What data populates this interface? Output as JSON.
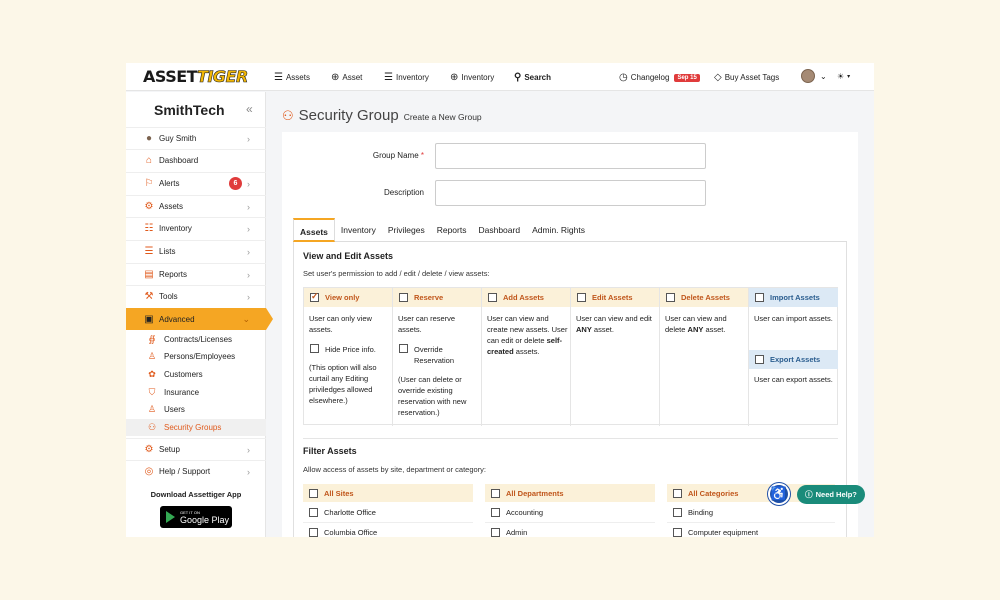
{
  "brand": {
    "logo_a": "ASSET",
    "logo_b": "TIGER"
  },
  "topnav": {
    "items": [
      {
        "icon": "list-icon",
        "label": "Assets"
      },
      {
        "icon": "plus-circle-icon",
        "label": "Asset"
      },
      {
        "icon": "list-icon",
        "label": "Inventory"
      },
      {
        "icon": "plus-circle-icon",
        "label": "Inventory"
      },
      {
        "icon": "search-icon",
        "label": "Search"
      }
    ],
    "changelog": "Changelog",
    "changelog_badge": "Sep 15",
    "buy_tags": "Buy Asset Tags"
  },
  "sidebar": {
    "company": "SmithTech",
    "items": [
      {
        "label": "Guy Smith",
        "icon": "user-avatar-icon"
      },
      {
        "label": "Dashboard",
        "icon": "home-icon"
      },
      {
        "label": "Alerts",
        "icon": "flag-icon",
        "badge": "6"
      },
      {
        "label": "Assets",
        "icon": "gear-icon"
      },
      {
        "label": "Inventory",
        "icon": "inventory-icon"
      },
      {
        "label": "Lists",
        "icon": "list-icon"
      },
      {
        "label": "Reports",
        "icon": "report-icon"
      },
      {
        "label": "Tools",
        "icon": "wrench-icon"
      },
      {
        "label": "Advanced",
        "icon": "briefcase-icon"
      }
    ],
    "subitems": [
      {
        "label": "Contracts/Licenses",
        "icon": "contract-icon"
      },
      {
        "label": "Persons/Employees",
        "icon": "person-icon"
      },
      {
        "label": "Customers",
        "icon": "customers-icon"
      },
      {
        "label": "Insurance",
        "icon": "shield-icon"
      },
      {
        "label": "Users",
        "icon": "users-icon"
      },
      {
        "label": "Security Groups",
        "icon": "security-group-icon"
      }
    ],
    "bottom_items": [
      {
        "label": "Setup",
        "icon": "gear-icon"
      },
      {
        "label": "Help / Support",
        "icon": "lifebuoy-icon"
      }
    ],
    "download": "Download Assettiger App",
    "gplay_small": "GET IT ON",
    "gplay_big": "Google Play"
  },
  "page": {
    "title": "Security Group",
    "subtitle": "Create a New Group"
  },
  "form": {
    "group_name_label": "Group Name",
    "required_mark": "*",
    "description_label": "Description",
    "group_name_value": "",
    "description_value": ""
  },
  "tabs": [
    "Assets",
    "Inventory",
    "Privileges",
    "Reports",
    "Dashboard",
    "Admin. Rights"
  ],
  "view_edit": {
    "title": "View and Edit Assets",
    "desc": "Set user's permission to add / edit / delete / view assets:",
    "cols": [
      {
        "head": "View only",
        "checked": true,
        "body": "User can only view assets."
      },
      {
        "head": "Reserve",
        "checked": false,
        "body": "User can reserve assets."
      },
      {
        "head": "Add Assets",
        "checked": false,
        "body_a": "User can view and create new assets. User can edit or delete ",
        "body_b": "self-created",
        "body_c": " assets."
      },
      {
        "head": "Edit Assets",
        "checked": false,
        "body_a": "User can view and edit ",
        "body_b": "ANY",
        "body_c": " asset."
      },
      {
        "head": "Delete Assets",
        "checked": false,
        "body_a": "User can view and delete ",
        "body_b": "ANY",
        "body_c": " asset."
      },
      {
        "head": "Import Assets",
        "checked": false,
        "body": "User can import assets."
      },
      {
        "head": "Export Assets",
        "checked": false,
        "body": "User can export assets."
      }
    ],
    "hide_price_label": "Hide Price info.",
    "hide_price_note": "(This option will also curtail any Editing priviledges allowed elsewhere.)",
    "override_label": "Override Reservation",
    "override_note": "(User can delete or override existing reservation with new reservation.)"
  },
  "filter": {
    "title": "Filter Assets",
    "desc": "Allow access of assets by site, department or category:",
    "sites": {
      "head": "All Sites",
      "rows": [
        "Charlotte Office",
        "Columbia Office"
      ]
    },
    "departments": {
      "head": "All Departments",
      "rows": [
        "Accounting",
        "Admin"
      ]
    },
    "categories": {
      "head": "All Categories",
      "rows": [
        "Binding",
        "Computer equipment"
      ]
    }
  },
  "help": {
    "need_help": "Need Help?"
  }
}
